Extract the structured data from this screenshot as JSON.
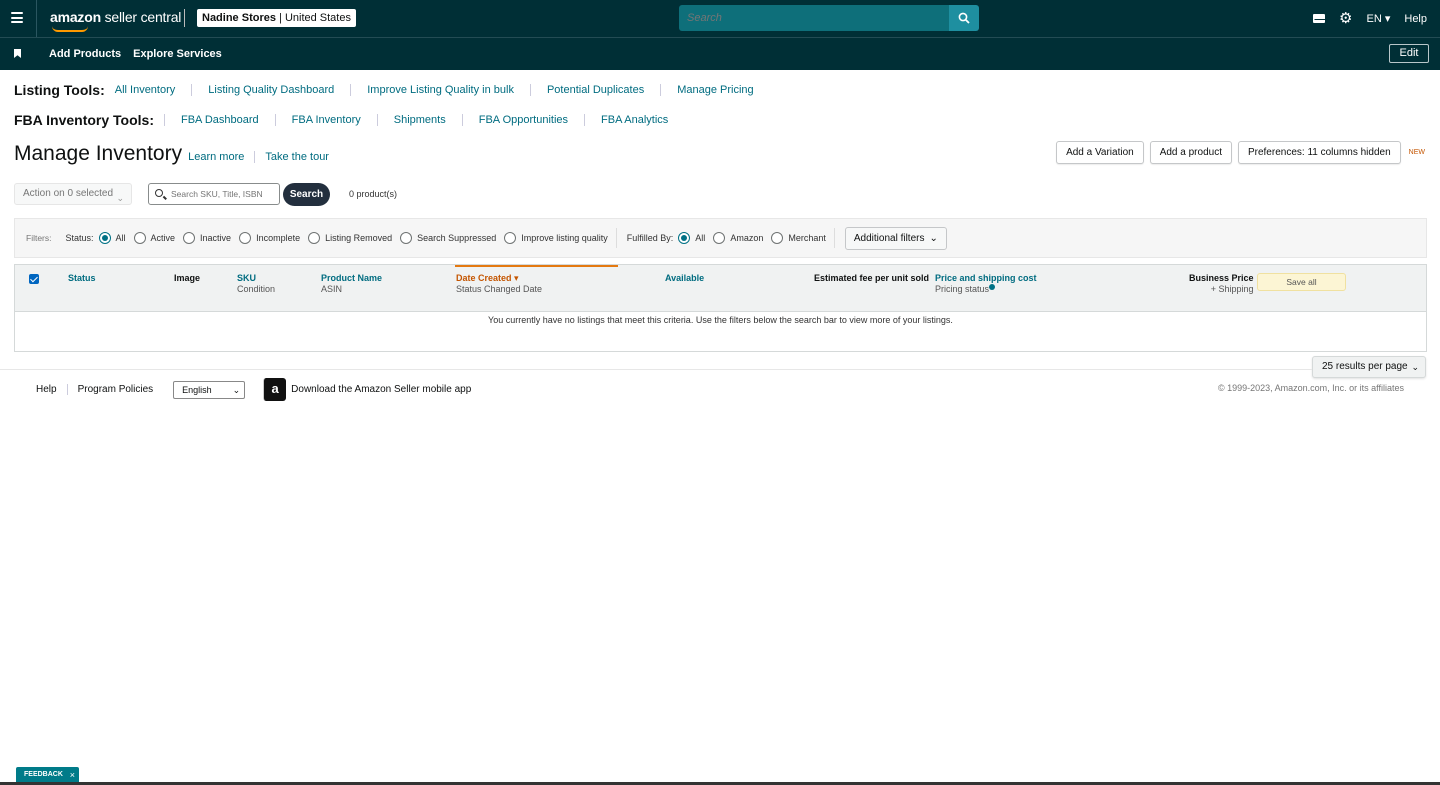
{
  "header": {
    "logo_text_bold": "amazon",
    "logo_text_rest": " seller central",
    "store_name": "Nadine Stores",
    "store_region": " | United States",
    "search_placeholder": "Search",
    "language": "EN",
    "help": "Help"
  },
  "subnav": {
    "items": [
      "Add Products",
      "Explore Services"
    ],
    "edit_label": "Edit"
  },
  "listing_tools": {
    "label": "Listing Tools:",
    "items": [
      "All Inventory",
      "Listing Quality Dashboard",
      "Improve Listing Quality in bulk",
      "Potential Duplicates",
      "Manage Pricing"
    ]
  },
  "fba_tools": {
    "label": "FBA Inventory Tools:",
    "items": [
      "FBA Dashboard",
      "FBA Inventory",
      "Shipments",
      "FBA Opportunities",
      "FBA Analytics"
    ]
  },
  "page": {
    "title": "Manage Inventory",
    "learn_more": "Learn more",
    "take_tour": "Take the tour",
    "add_variation": "Add a Variation",
    "add_product": "Add a product",
    "preferences": "Preferences: 11 columns hidden",
    "new_badge": "NEW"
  },
  "actions": {
    "action_select": "Action on 0 selected",
    "search_placeholder": "Search SKU, Title, ISBN",
    "search_button": "Search",
    "product_count": "0 product(s)"
  },
  "filters": {
    "label": "Filters:",
    "status_label": "Status:",
    "status_options": [
      "All",
      "Active",
      "Inactive",
      "Incomplete",
      "Listing Removed",
      "Search Suppressed",
      "Improve listing quality"
    ],
    "status_selected": "All",
    "fulfilled_label": "Fulfilled By:",
    "fulfilled_options": [
      "All",
      "Amazon",
      "Merchant"
    ],
    "fulfilled_selected": "All",
    "additional_filters": "Additional filters"
  },
  "table": {
    "columns": {
      "status": "Status",
      "image": "Image",
      "sku": "SKU",
      "sku_sub": "Condition",
      "product_name": "Product Name",
      "product_name_sub": "ASIN",
      "date_created": "Date Created",
      "date_created_sub": "Status Changed Date",
      "available": "Available",
      "estimated_fee": "Estimated fee per unit sold",
      "price_shipping": "Price and shipping cost",
      "price_shipping_sub": "Pricing status",
      "business_price": "Business Price",
      "business_price_sub": "+ Shipping"
    },
    "save_all": "Save all",
    "empty_message": "You currently have no listings that meet this criteria. Use the filters below the search bar to view more of your listings.",
    "per_page": "25 results per page"
  },
  "footer": {
    "help": "Help",
    "program_policies": "Program Policies",
    "language": "English",
    "app_icon_glyph": "a",
    "app_download": "Download the Amazon Seller mobile app",
    "copyright": "© 1999-2023, Amazon.com, Inc. or its affiliates"
  },
  "feedback": {
    "label": "FEEDBACK",
    "close": "×"
  },
  "colors": {
    "header_bg": "#002f36",
    "link": "#006c80",
    "accent_orange": "#e47911",
    "teal_button": "#007b89"
  }
}
